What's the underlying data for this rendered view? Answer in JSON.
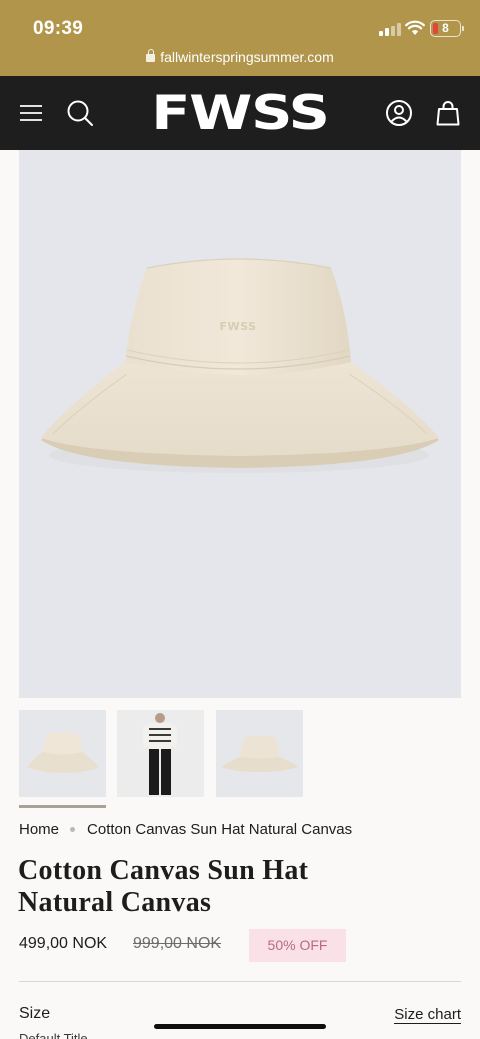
{
  "status_bar": {
    "time": "09:39",
    "battery": "8"
  },
  "browser": {
    "url": "fallwinterspringsummer.com"
  },
  "header": {
    "logo": "FWSS"
  },
  "icons": {
    "menu": "menu-icon",
    "search": "search-icon",
    "account": "account-icon",
    "cart": "cart-icon"
  },
  "colors": {
    "status_bar_bg": "#b0954a",
    "header_bg": "#1e1e1e",
    "badge_bg": "#fae1e8",
    "badge_text": "#b56b80"
  },
  "breadcrumb": {
    "home": "Home",
    "current": "Cotton Canvas Sun Hat Natural Canvas"
  },
  "product": {
    "title_line1": "Cotton Canvas Sun Hat",
    "title_line2": "Natural Canvas",
    "price": "499,00 NOK",
    "compare_price": "999,00 NOK",
    "discount_badge": "50% OFF",
    "hat_print": "FWSS"
  },
  "gallery": {
    "thumbnail_count": 3,
    "selected_index": 0
  },
  "options": {
    "size_label": "Size",
    "size_chart": "Size chart",
    "size_value": "Default Title"
  }
}
